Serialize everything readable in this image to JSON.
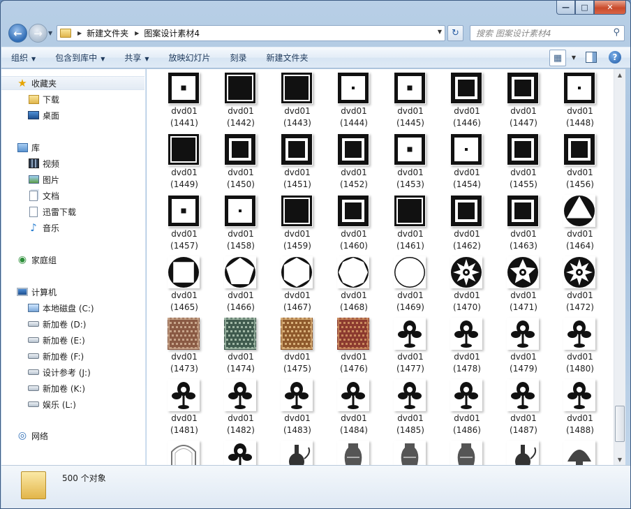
{
  "breadcrumb": [
    "新建文件夹",
    "图案设计素材4"
  ],
  "search": {
    "placeholder": "搜索 图案设计素材4"
  },
  "toolbar": {
    "organize": "组织",
    "include_in_library": "包含到库中",
    "share": "共享",
    "slideshow": "放映幻灯片",
    "burn": "刻录",
    "new_folder": "新建文件夹"
  },
  "sidebar": {
    "favorites": {
      "label": "收藏夹",
      "icon": "star-icon",
      "items": [
        {
          "label": "下载",
          "icon": "download-folder-icon"
        },
        {
          "label": "桌面",
          "icon": "desktop-icon"
        }
      ]
    },
    "libraries": {
      "label": "库",
      "icon": "library-icon",
      "items": [
        {
          "label": "视频",
          "icon": "video-icon"
        },
        {
          "label": "图片",
          "icon": "picture-icon"
        },
        {
          "label": "文档",
          "icon": "document-icon"
        },
        {
          "label": "迅雷下载",
          "icon": "thunder-download-icon"
        },
        {
          "label": "音乐",
          "icon": "music-icon"
        }
      ]
    },
    "homegroup": {
      "label": "家庭组",
      "icon": "homegroup-icon"
    },
    "computer": {
      "label": "计算机",
      "icon": "computer-icon",
      "items": [
        {
          "label": "本地磁盘 (C:)",
          "icon": "system-drive-icon"
        },
        {
          "label": "新加卷 (D:)",
          "icon": "drive-icon"
        },
        {
          "label": "新加卷 (E:)",
          "icon": "drive-icon"
        },
        {
          "label": "新加卷 (F:)",
          "icon": "drive-icon"
        },
        {
          "label": "设计参考 (J:)",
          "icon": "drive-icon"
        },
        {
          "label": "新加卷 (K:)",
          "icon": "drive-icon"
        },
        {
          "label": "娱乐 (L:)",
          "icon": "drive-icon"
        }
      ]
    },
    "network": {
      "label": "网络",
      "icon": "network-icon"
    }
  },
  "files": {
    "name_prefix": "dvd01",
    "rows": [
      [
        "(1441)",
        "(1442)",
        "(1443)",
        "(1444)",
        "(1445)",
        "(1446)",
        "(1447)",
        "(1448)"
      ],
      [
        "(1449)",
        "(1450)",
        "(1451)",
        "(1452)",
        "(1453)",
        "(1454)",
        "(1455)",
        "(1456)"
      ],
      [
        "(1457)",
        "(1458)",
        "(1459)",
        "(1460)",
        "(1461)",
        "(1462)",
        "(1463)",
        "(1464)"
      ],
      [
        "(1465)",
        "(1466)",
        "(1467)",
        "(1468)",
        "(1469)",
        "(1470)",
        "(1471)",
        "(1472)"
      ],
      [
        "(1473)",
        "(1474)",
        "(1475)",
        "(1476)",
        "(1477)",
        "(1478)",
        "(1479)",
        "(1480)"
      ],
      [
        "(1481)",
        "(1482)",
        "(1483)",
        "(1484)",
        "(1485)",
        "(1486)",
        "(1487)",
        "(1488)"
      ]
    ],
    "thumb_kinds": [
      [
        "square-dot",
        "square-filled",
        "square-filled",
        "square-dot",
        "square-dot",
        "square-frame",
        "square-frame",
        "square-dot"
      ],
      [
        "square-filled",
        "square-frame",
        "square-frame",
        "square-frame",
        "square-dot",
        "square-dot",
        "square-frame",
        "square-frame"
      ],
      [
        "square-dot",
        "square-dot",
        "square-filled",
        "square-frame",
        "square-filled",
        "square-frame",
        "square-frame",
        "circle-triangle"
      ],
      [
        "circle-square",
        "circle-pentagon",
        "circle-hexagon",
        "circle-octagon",
        "circle-ring",
        "circle-star",
        "circle-star",
        "circle-star"
      ],
      [
        "textile-brown",
        "textile-green",
        "textile-orange",
        "textile-red",
        "floral",
        "floral",
        "floral",
        "floral"
      ],
      [
        "floral",
        "floral",
        "floral",
        "floral",
        "floral",
        "floral",
        "floral",
        "floral"
      ],
      [
        "arch",
        "floral",
        "ewer",
        "vase",
        "vase",
        "vase",
        "ewer",
        "dome"
      ]
    ]
  },
  "status": {
    "count": "500 个对象"
  }
}
